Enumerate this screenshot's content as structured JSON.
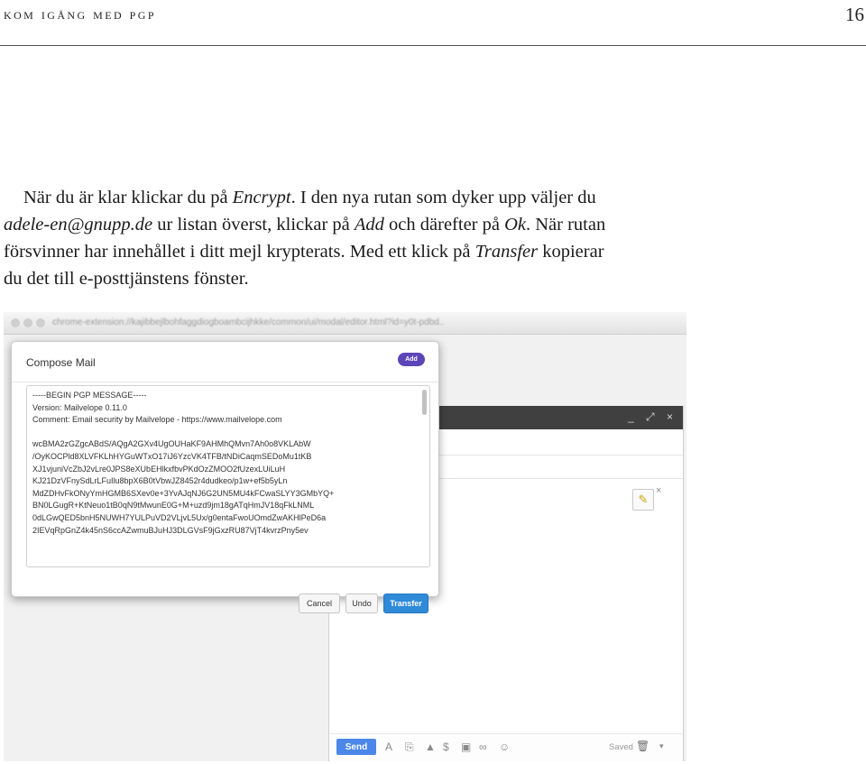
{
  "header": {
    "running_head": "kom igång med pgp",
    "page_number": "16"
  },
  "paragraph": {
    "l1_a": "När du är klar klickar du på ",
    "l1_b": "Encrypt",
    "l1_c": ". I den nya rutan som dyker upp väljer du",
    "l2_a": "adele-en@gnupp.de",
    "l2_b": " ur listan överst, klickar på ",
    "l2_c": "Add",
    "l2_d": " och därefter på ",
    "l2_e": "Ok",
    "l2_f": ". När rutan",
    "l3": "försvinner har innehållet i ditt mejl krypterats. Med ett klick på ",
    "l3_b": "Transfer",
    "l3_c": " kopierar",
    "l4": "du det till e-posttjänstens fönster."
  },
  "screenshot": {
    "url": "chrome-extension://kajibbejlbohfaggdiogboambcijhkke/common/ui/modal/editor.html?id=y0t-pdbd..",
    "modal": {
      "title": "Compose Mail",
      "pill_label": "Add",
      "armor_lines": [
        "-----BEGIN PGP MESSAGE-----",
        "Version: Mailvelope 0.11.0",
        "Comment: Email security by Mailvelope - https://www.mailvelope.com",
        "",
        "wcBMA2zGZgcABdS/AQgA2GXv4UgOUHaKF9AHMhQMvn7Ah0o8VKLAbW",
        "/OyKOCPld8XLVFKLhHYGuWTxO17iJ6YzcVK4TFB/tNDiCaqmSEDoMu1tKB",
        "XJ1vjuniVcZbJ2vLre0JPS8eXUbEHlkxfbvPKdOzZMOO2fUzexLUiLuH",
        "KJ21DzVFnySdLrLFuIlu8bpX6B0tVbwJZ8452r4dudkeo/p1w+ef5b5yLn",
        "MdZDHvFkONyYmHGMB6SXev0e+3YvAJqNJ6G2UN5MU4kFCwaSLYY3GMbYQ+",
        "BN0LGugR+KtNeuo1tB0qN9tMwunE0G+M+uzd9jm18gATqHmJV18qFkLNML",
        "0dLGwQED5bnH5NUWH7YULPuVD2VLjvL5Ux/g0entaFwoUOmdZwAKHlPeD6a",
        "2IEVqRpGnZ4k45nS6ccAZwmuBJuHJ3DLGVsF9jGxzRU87VjT4kvrzPny5ev"
      ],
      "cancel_label": "Cancel",
      "undo_label": "Undo",
      "transfer_label": "Transfer"
    },
    "gmail": {
      "send_label": "Send",
      "saved_label": "Saved",
      "window_controls": "_ ⤢ ×"
    }
  }
}
